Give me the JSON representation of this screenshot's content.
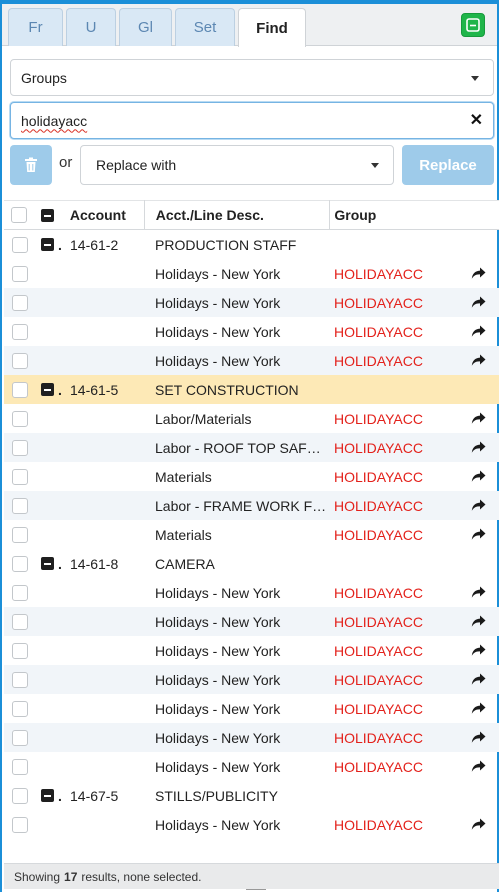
{
  "tabs": [
    {
      "label": "Fr",
      "active": false
    },
    {
      "label": "U",
      "active": false
    },
    {
      "label": "Gl",
      "active": false
    },
    {
      "label": "Set",
      "active": false
    },
    {
      "label": "Find",
      "active": true
    }
  ],
  "scope_select": {
    "value": "Groups"
  },
  "search": {
    "value": "holidayacc"
  },
  "bulk": {
    "or_label": "or",
    "replace_select": {
      "value": "Replace with"
    },
    "replace_button": "Replace"
  },
  "table": {
    "columns": [
      "Account",
      "Acct./Line Desc.",
      "Group"
    ],
    "rows": [
      {
        "type": "group",
        "account": "14-61-2",
        "desc": "PRODUCTION STAFF"
      },
      {
        "type": "item",
        "desc": "Holidays - New York",
        "group": "HOLIDAYACC"
      },
      {
        "type": "item",
        "desc": "Holidays - New York",
        "group": "HOLIDAYACC"
      },
      {
        "type": "item",
        "desc": "Holidays - New York",
        "group": "HOLIDAYACC"
      },
      {
        "type": "item",
        "desc": "Holidays - New York",
        "group": "HOLIDAYACC"
      },
      {
        "type": "group",
        "account": "14-61-5",
        "desc": "SET CONSTRUCTION",
        "highlighted": true
      },
      {
        "type": "item",
        "desc": "Labor/Materials",
        "group": "HOLIDAYACC"
      },
      {
        "type": "item",
        "desc": "Labor - ROOF TOP SAFETY",
        "group": "HOLIDAYACC"
      },
      {
        "type": "item",
        "desc": "Materials",
        "group": "HOLIDAYACC"
      },
      {
        "type": "item",
        "desc": "Labor - FRAME WORK FOR",
        "group": "HOLIDAYACC"
      },
      {
        "type": "item",
        "desc": "Materials",
        "group": "HOLIDAYACC"
      },
      {
        "type": "group",
        "account": "14-61-8",
        "desc": "CAMERA"
      },
      {
        "type": "item",
        "desc": "Holidays - New York",
        "group": "HOLIDAYACC"
      },
      {
        "type": "item",
        "desc": "Holidays - New York",
        "group": "HOLIDAYACC"
      },
      {
        "type": "item",
        "desc": "Holidays - New York",
        "group": "HOLIDAYACC"
      },
      {
        "type": "item",
        "desc": "Holidays - New York",
        "group": "HOLIDAYACC"
      },
      {
        "type": "item",
        "desc": "Holidays - New York",
        "group": "HOLIDAYACC"
      },
      {
        "type": "item",
        "desc": "Holidays - New York",
        "group": "HOLIDAYACC"
      },
      {
        "type": "item",
        "desc": "Holidays - New York",
        "group": "HOLIDAYACC"
      },
      {
        "type": "group",
        "account": "14-67-5",
        "desc": "STILLS/PUBLICITY"
      },
      {
        "type": "item",
        "desc": "Holidays - New York",
        "group": "HOLIDAYACC"
      }
    ]
  },
  "status": {
    "prefix": "Showing",
    "count": "17",
    "suffix": "results, none selected."
  },
  "colors": {
    "accent": "#1b8fd8",
    "group_text": "#e3211b",
    "highlight_row": "#fde9b6",
    "action_green": "#1fb54a"
  }
}
